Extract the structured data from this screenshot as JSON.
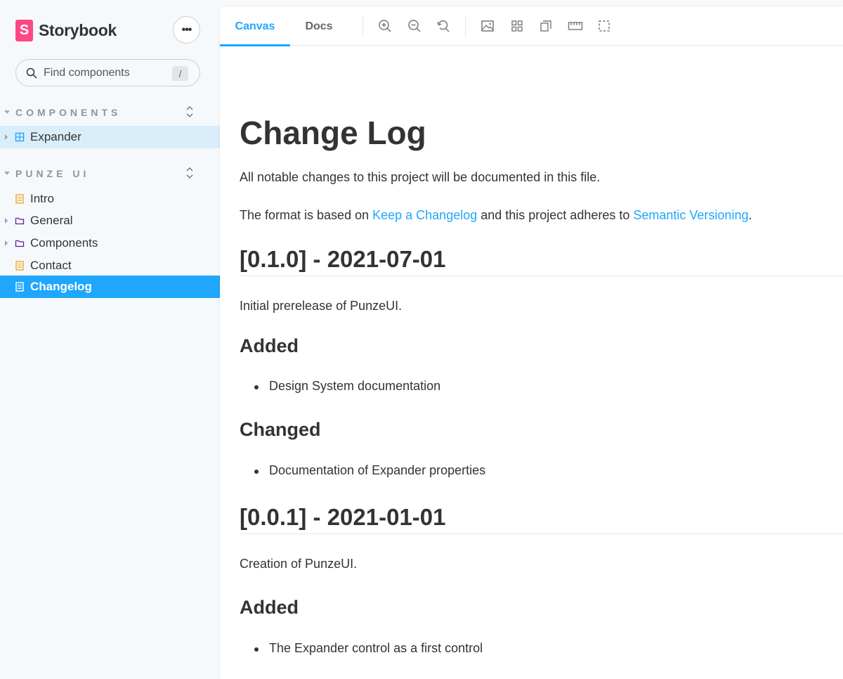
{
  "brand": {
    "logo_letter": "S",
    "name": "Storybook",
    "accent": "#FF4785"
  },
  "menu": {
    "label": "•••"
  },
  "search": {
    "placeholder": "Find components",
    "shortcut": "/"
  },
  "sidebar": {
    "groups": [
      {
        "label": "COMPONENTS",
        "items": [
          {
            "label": "Expander",
            "icon": "component-icon",
            "expandable": true,
            "state": "hover"
          }
        ]
      },
      {
        "label": "PUNZE UI",
        "items": [
          {
            "label": "Intro",
            "icon": "document-icon",
            "expandable": false
          },
          {
            "label": "General",
            "icon": "folder-icon",
            "expandable": true
          },
          {
            "label": "Components",
            "icon": "folder-icon",
            "expandable": true
          },
          {
            "label": "Contact",
            "icon": "document-icon",
            "expandable": false
          },
          {
            "label": "Changelog",
            "icon": "document-icon",
            "expandable": false,
            "state": "selected"
          }
        ]
      }
    ]
  },
  "toolbar": {
    "tabs": [
      {
        "label": "Canvas",
        "active": true
      },
      {
        "label": "Docs",
        "active": false
      }
    ],
    "tools": [
      "zoom-in-icon",
      "zoom-out-icon",
      "zoom-reset-icon",
      "background-icon",
      "grid-icon",
      "viewport-icon",
      "measure-icon",
      "outline-icon"
    ]
  },
  "doc": {
    "title": "Change Log",
    "intro": "All notable changes to this project will be documented in this file.",
    "format_prefix": "The format is based on ",
    "format_link1": "Keep a Changelog",
    "format_middle": " and this project adheres to ",
    "format_link2": "Semantic Versioning",
    "format_suffix": ".",
    "releases": [
      {
        "heading": "[0.1.0] - 2021-07-01",
        "description": "Initial prerelease of PunzeUI.",
        "sections": [
          {
            "heading": "Added",
            "items": [
              "Design System documentation"
            ]
          },
          {
            "heading": "Changed",
            "items": [
              "Documentation of Expander properties"
            ]
          }
        ]
      },
      {
        "heading": "[0.0.1] - 2021-01-01",
        "description": "Creation of PunzeUI.",
        "sections": [
          {
            "heading": "Added",
            "items": [
              "The Expander control as a first control"
            ]
          }
        ]
      }
    ]
  },
  "colors": {
    "accent": "#1EA7FD",
    "sidebar_bg": "#F6F9FC",
    "selected_bg": "#1EA7FD",
    "hover_bg": "#D9EDFA",
    "doc_icon": "#F5A623",
    "folder_icon": "#6A1B9A"
  }
}
